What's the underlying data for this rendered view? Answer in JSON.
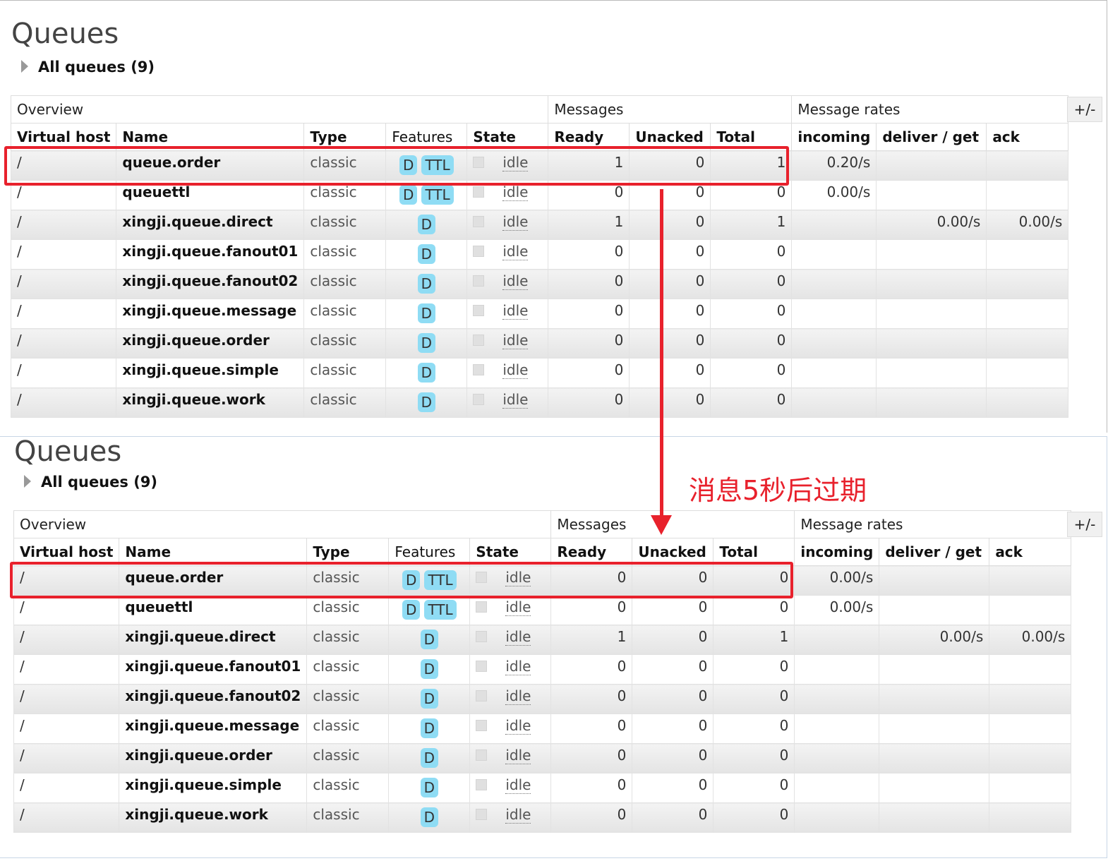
{
  "panels": [
    {
      "title": "Queues",
      "subtitle": "All queues (9)",
      "toggle_label": "+/-",
      "groups": [
        "Overview",
        "Messages",
        "Message rates"
      ],
      "columns": [
        "Virtual host",
        "Name",
        "Type",
        "Features",
        "State",
        "Ready",
        "Unacked",
        "Total",
        "incoming",
        "deliver / get",
        "ack"
      ],
      "rows": [
        {
          "vhost": "/",
          "name": "queue.order",
          "type": "classic",
          "features": [
            "D",
            "TTL"
          ],
          "state": "idle",
          "ready": "1",
          "unacked": "0",
          "total": "1",
          "incoming": "0.20/s",
          "deliver": "",
          "ack": ""
        },
        {
          "vhost": "/",
          "name": "queuettl",
          "type": "classic",
          "features": [
            "D",
            "TTL"
          ],
          "state": "idle",
          "ready": "0",
          "unacked": "0",
          "total": "0",
          "incoming": "0.00/s",
          "deliver": "",
          "ack": ""
        },
        {
          "vhost": "/",
          "name": "xingji.queue.direct",
          "type": "classic",
          "features": [
            "D"
          ],
          "state": "idle",
          "ready": "1",
          "unacked": "0",
          "total": "1",
          "incoming": "",
          "deliver": "0.00/s",
          "ack": "0.00/s"
        },
        {
          "vhost": "/",
          "name": "xingji.queue.fanout01",
          "type": "classic",
          "features": [
            "D"
          ],
          "state": "idle",
          "ready": "0",
          "unacked": "0",
          "total": "0",
          "incoming": "",
          "deliver": "",
          "ack": ""
        },
        {
          "vhost": "/",
          "name": "xingji.queue.fanout02",
          "type": "classic",
          "features": [
            "D"
          ],
          "state": "idle",
          "ready": "0",
          "unacked": "0",
          "total": "0",
          "incoming": "",
          "deliver": "",
          "ack": ""
        },
        {
          "vhost": "/",
          "name": "xingji.queue.message",
          "type": "classic",
          "features": [
            "D"
          ],
          "state": "idle",
          "ready": "0",
          "unacked": "0",
          "total": "0",
          "incoming": "",
          "deliver": "",
          "ack": ""
        },
        {
          "vhost": "/",
          "name": "xingji.queue.order",
          "type": "classic",
          "features": [
            "D"
          ],
          "state": "idle",
          "ready": "0",
          "unacked": "0",
          "total": "0",
          "incoming": "",
          "deliver": "",
          "ack": ""
        },
        {
          "vhost": "/",
          "name": "xingji.queue.simple",
          "type": "classic",
          "features": [
            "D"
          ],
          "state": "idle",
          "ready": "0",
          "unacked": "0",
          "total": "0",
          "incoming": "",
          "deliver": "",
          "ack": ""
        },
        {
          "vhost": "/",
          "name": "xingji.queue.work",
          "type": "classic",
          "features": [
            "D"
          ],
          "state": "idle",
          "ready": "0",
          "unacked": "0",
          "total": "0",
          "incoming": "",
          "deliver": "",
          "ack": ""
        }
      ]
    },
    {
      "title": "Queues",
      "subtitle": "All queues (9)",
      "toggle_label": "+/-",
      "groups": [
        "Overview",
        "Messages",
        "Message rates"
      ],
      "columns": [
        "Virtual host",
        "Name",
        "Type",
        "Features",
        "State",
        "Ready",
        "Unacked",
        "Total",
        "incoming",
        "deliver / get",
        "ack"
      ],
      "rows": [
        {
          "vhost": "/",
          "name": "queue.order",
          "type": "classic",
          "features": [
            "D",
            "TTL"
          ],
          "state": "idle",
          "ready": "0",
          "unacked": "0",
          "total": "0",
          "incoming": "0.00/s",
          "deliver": "",
          "ack": ""
        },
        {
          "vhost": "/",
          "name": "queuettl",
          "type": "classic",
          "features": [
            "D",
            "TTL"
          ],
          "state": "idle",
          "ready": "0",
          "unacked": "0",
          "total": "0",
          "incoming": "0.00/s",
          "deliver": "",
          "ack": ""
        },
        {
          "vhost": "/",
          "name": "xingji.queue.direct",
          "type": "classic",
          "features": [
            "D"
          ],
          "state": "idle",
          "ready": "1",
          "unacked": "0",
          "total": "1",
          "incoming": "",
          "deliver": "0.00/s",
          "ack": "0.00/s"
        },
        {
          "vhost": "/",
          "name": "xingji.queue.fanout01",
          "type": "classic",
          "features": [
            "D"
          ],
          "state": "idle",
          "ready": "0",
          "unacked": "0",
          "total": "0",
          "incoming": "",
          "deliver": "",
          "ack": ""
        },
        {
          "vhost": "/",
          "name": "xingji.queue.fanout02",
          "type": "classic",
          "features": [
            "D"
          ],
          "state": "idle",
          "ready": "0",
          "unacked": "0",
          "total": "0",
          "incoming": "",
          "deliver": "",
          "ack": ""
        },
        {
          "vhost": "/",
          "name": "xingji.queue.message",
          "type": "classic",
          "features": [
            "D"
          ],
          "state": "idle",
          "ready": "0",
          "unacked": "0",
          "total": "0",
          "incoming": "",
          "deliver": "",
          "ack": ""
        },
        {
          "vhost": "/",
          "name": "xingji.queue.order",
          "type": "classic",
          "features": [
            "D"
          ],
          "state": "idle",
          "ready": "0",
          "unacked": "0",
          "total": "0",
          "incoming": "",
          "deliver": "",
          "ack": ""
        },
        {
          "vhost": "/",
          "name": "xingji.queue.simple",
          "type": "classic",
          "features": [
            "D"
          ],
          "state": "idle",
          "ready": "0",
          "unacked": "0",
          "total": "0",
          "incoming": "",
          "deliver": "",
          "ack": ""
        },
        {
          "vhost": "/",
          "name": "xingji.queue.work",
          "type": "classic",
          "features": [
            "D"
          ],
          "state": "idle",
          "ready": "0",
          "unacked": "0",
          "total": "0",
          "incoming": "",
          "deliver": "",
          "ack": ""
        }
      ]
    }
  ],
  "annotation": {
    "text": "消息5秒后过期",
    "color": "#e8212c"
  },
  "colors": {
    "highlight": "#e8212c",
    "feature_badge": "#8fdcf4"
  }
}
